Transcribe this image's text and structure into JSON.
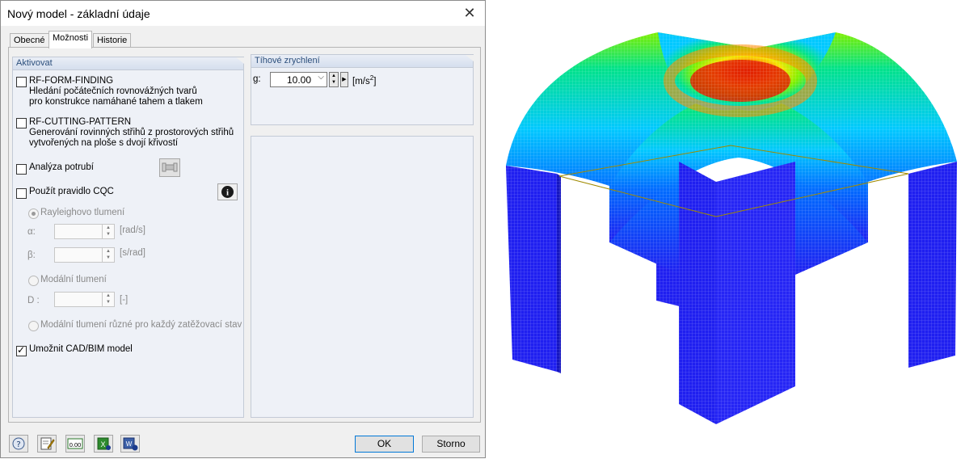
{
  "dialog": {
    "title": "Nový model - základní údaje",
    "tabs": [
      {
        "label": "Obecné"
      },
      {
        "label": "Možnosti"
      },
      {
        "label": "Historie"
      }
    ],
    "activate_group": {
      "header": "Aktivovat",
      "rf_form_finding": {
        "label": "RF-FORM-FINDING",
        "desc1": "Hledání počátečních rovnovážných tvarů",
        "desc2": "pro konstrukce namáhané tahem a tlakem",
        "checked": false
      },
      "rf_cutting_pattern": {
        "label": "RF-CUTTING-PATTERN",
        "desc1": "Generování rovinných střihů z prostorových střihů",
        "desc2": "vytvořených na ploše s dvojí křivostí",
        "checked": false
      },
      "pipe_analysis": {
        "label": "Analýza potrubí",
        "checked": false
      },
      "cqc_rule": {
        "label": "Použít pravidlo CQC",
        "checked": false
      },
      "rayleigh": {
        "label": "Rayleighovo tlumení",
        "selected": true
      },
      "alpha": {
        "label": "α:",
        "value": "",
        "unit": "[rad/s]"
      },
      "beta": {
        "label": "β:",
        "value": "",
        "unit": "[s/rad]"
      },
      "modal": {
        "label": "Modální tlumení",
        "selected": false
      },
      "d": {
        "label": "D :",
        "value": "",
        "unit": "[-]"
      },
      "modal_per_case": {
        "label": "Modální tlumení různé pro každý zatěžovací stav",
        "selected": false
      },
      "cad_bim": {
        "label": "Umožnit CAD/BIM model",
        "checked": true
      }
    },
    "gravity_group": {
      "header": "Tíhové zrychlení",
      "g_label": "g:",
      "g_value": "10.00",
      "g_unit_prefix": "[m/s",
      "g_unit_sup": "2",
      "g_unit_suffix": "]"
    },
    "buttons": {
      "ok": "OK",
      "cancel": "Storno"
    },
    "toolbar_icons": [
      "help-icon",
      "edit-icon",
      "units-icon",
      "excel-import-icon",
      "info-icon"
    ],
    "toolbar_units_text": "0.00"
  },
  "view": {
    "colors": [
      "#1f1ff0",
      "#006cff",
      "#00c8ff",
      "#00e28a",
      "#7ef000",
      "#f5e600",
      "#ff8c00",
      "#e02000"
    ]
  }
}
